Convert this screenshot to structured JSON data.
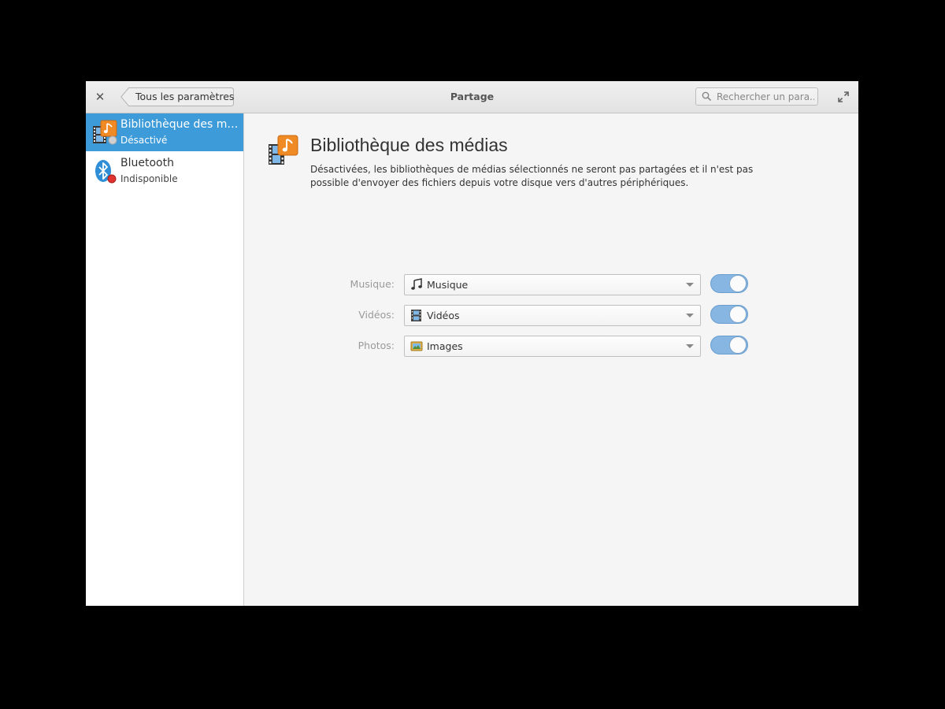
{
  "window": {
    "title": "Partage",
    "back_label": "Tous les paramètres",
    "search_placeholder": "Rechercher un para..."
  },
  "sidebar": {
    "items": [
      {
        "name": "Bibliothèque des médias",
        "status": "Désactivé",
        "selected": true
      },
      {
        "name": "Bluetooth",
        "status": "Indisponible",
        "selected": false
      }
    ]
  },
  "main": {
    "title": "Bibliothèque des médias",
    "description": "Désactivées, les bibliothèques de médias sélectionnés ne seront pas partagées et il n'est pas possible d'envoyer des fichiers depuis votre disque vers d'autres périphériques.",
    "service_enabled": false,
    "rows": [
      {
        "label": "Musique:",
        "value": "Musique",
        "icon": "music-note-icon",
        "enabled": true
      },
      {
        "label": "Vidéos:",
        "value": "Vidéos",
        "icon": "film-icon",
        "enabled": true
      },
      {
        "label": "Photos:",
        "value": "Images",
        "icon": "pictures-folder-icon",
        "enabled": true
      }
    ]
  },
  "colors": {
    "accent": "#3d9bda",
    "toggle_on": "#86b6e1",
    "status_off": "#d0d0d0",
    "status_error": "#e0322f"
  }
}
